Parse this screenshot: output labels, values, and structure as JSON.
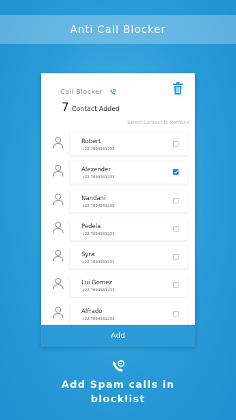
{
  "banner": {
    "title": "Anti Call Blocker"
  },
  "card": {
    "app_name": "Call Blocker",
    "count": "7",
    "count_label": "Contact Added",
    "hint": "Select Contact to Remove",
    "icons": {
      "app": "phone-shield-icon",
      "delete": "trash-icon",
      "contact": "person-icon"
    }
  },
  "contacts": [
    {
      "name": "Robert",
      "phone": "+22 7894561233",
      "selected": false
    },
    {
      "name": "Alexender",
      "phone": "+22 7894561233",
      "selected": true
    },
    {
      "name": "Nandani",
      "phone": "+22 7894561233",
      "selected": false
    },
    {
      "name": "Pedela",
      "phone": "+22 7894561233",
      "selected": false
    },
    {
      "name": "Syra",
      "phone": "+22 7894561233",
      "selected": false
    },
    {
      "name": "Lui Gomez",
      "phone": "+22 7894561233",
      "selected": false
    },
    {
      "name": "Alfrado",
      "phone": "+22 7894561233",
      "selected": false
    }
  ],
  "add_button": {
    "label": "Add"
  },
  "footer": {
    "line1": "Add Spam calls in",
    "line2": "blocklist"
  },
  "colors": {
    "accent": "#2a9bd8",
    "checked": "#1e86d4"
  }
}
